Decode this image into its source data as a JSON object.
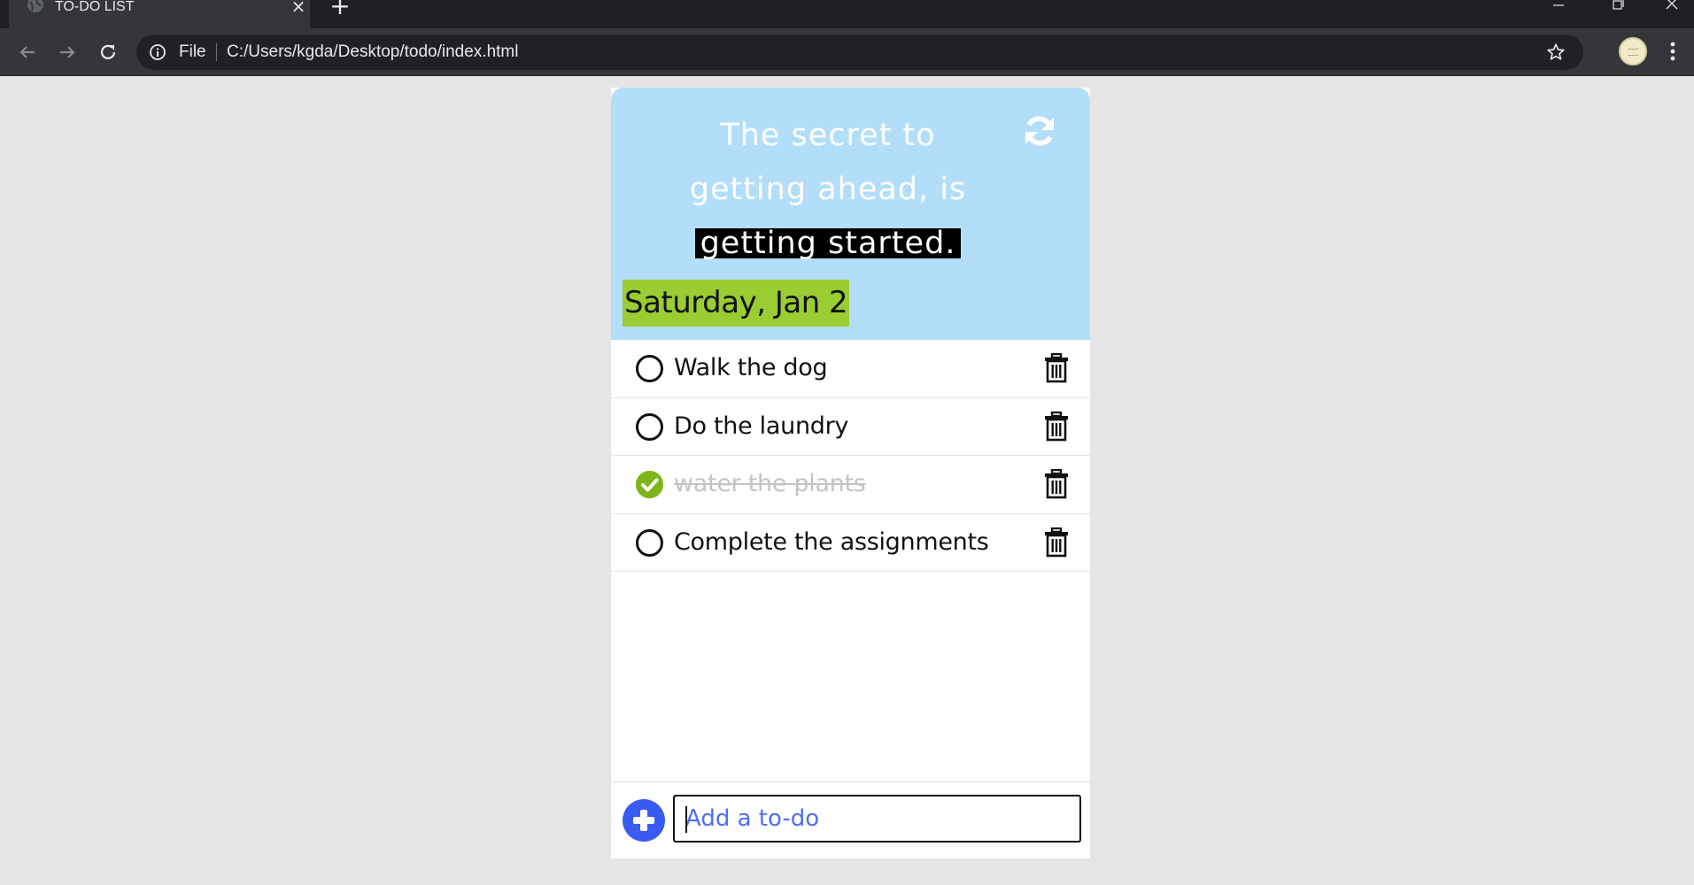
{
  "browser": {
    "tab_title": "TO-DO LIST",
    "file_label": "File",
    "url": "C:/Users/kgda/Desktop/todo/index.html",
    "icons": {
      "favicon": "globe-icon",
      "back": "arrow-left-icon",
      "forward": "arrow-right-icon",
      "reload": "reload-icon",
      "info": "info-icon",
      "bookmark": "star-icon",
      "menu": "kebab-menu-icon"
    }
  },
  "app": {
    "quote": {
      "line1": "The secret to",
      "line2": "getting ahead, is",
      "line3": "getting started."
    },
    "date": "Saturday, Jan 2",
    "colors": {
      "hero_bg": "#b3def9",
      "date_bg": "#9acd32",
      "done_check": "#7cb518",
      "add_button": "#3a5bf3",
      "placeholder": "#4f6ef2"
    },
    "todos": [
      {
        "text": "Walk the dog",
        "done": false
      },
      {
        "text": "Do the laundry",
        "done": false
      },
      {
        "text": "water the plants",
        "done": true
      },
      {
        "text": "Complete the assignments",
        "done": false
      }
    ],
    "input": {
      "placeholder": "Add a to-do",
      "value": ""
    }
  }
}
